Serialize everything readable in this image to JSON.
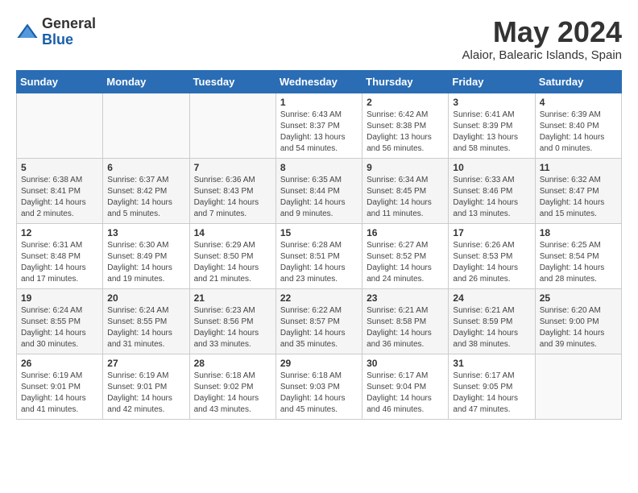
{
  "header": {
    "logo_general": "General",
    "logo_blue": "Blue",
    "month": "May 2024",
    "location": "Alaior, Balearic Islands, Spain"
  },
  "weekdays": [
    "Sunday",
    "Monday",
    "Tuesday",
    "Wednesday",
    "Thursday",
    "Friday",
    "Saturday"
  ],
  "weeks": [
    [
      {
        "day": "",
        "info": ""
      },
      {
        "day": "",
        "info": ""
      },
      {
        "day": "",
        "info": ""
      },
      {
        "day": "1",
        "info": "Sunrise: 6:43 AM\nSunset: 8:37 PM\nDaylight: 13 hours\nand 54 minutes."
      },
      {
        "day": "2",
        "info": "Sunrise: 6:42 AM\nSunset: 8:38 PM\nDaylight: 13 hours\nand 56 minutes."
      },
      {
        "day": "3",
        "info": "Sunrise: 6:41 AM\nSunset: 8:39 PM\nDaylight: 13 hours\nand 58 minutes."
      },
      {
        "day": "4",
        "info": "Sunrise: 6:39 AM\nSunset: 8:40 PM\nDaylight: 14 hours\nand 0 minutes."
      }
    ],
    [
      {
        "day": "5",
        "info": "Sunrise: 6:38 AM\nSunset: 8:41 PM\nDaylight: 14 hours\nand 2 minutes."
      },
      {
        "day": "6",
        "info": "Sunrise: 6:37 AM\nSunset: 8:42 PM\nDaylight: 14 hours\nand 5 minutes."
      },
      {
        "day": "7",
        "info": "Sunrise: 6:36 AM\nSunset: 8:43 PM\nDaylight: 14 hours\nand 7 minutes."
      },
      {
        "day": "8",
        "info": "Sunrise: 6:35 AM\nSunset: 8:44 PM\nDaylight: 14 hours\nand 9 minutes."
      },
      {
        "day": "9",
        "info": "Sunrise: 6:34 AM\nSunset: 8:45 PM\nDaylight: 14 hours\nand 11 minutes."
      },
      {
        "day": "10",
        "info": "Sunrise: 6:33 AM\nSunset: 8:46 PM\nDaylight: 14 hours\nand 13 minutes."
      },
      {
        "day": "11",
        "info": "Sunrise: 6:32 AM\nSunset: 8:47 PM\nDaylight: 14 hours\nand 15 minutes."
      }
    ],
    [
      {
        "day": "12",
        "info": "Sunrise: 6:31 AM\nSunset: 8:48 PM\nDaylight: 14 hours\nand 17 minutes."
      },
      {
        "day": "13",
        "info": "Sunrise: 6:30 AM\nSunset: 8:49 PM\nDaylight: 14 hours\nand 19 minutes."
      },
      {
        "day": "14",
        "info": "Sunrise: 6:29 AM\nSunset: 8:50 PM\nDaylight: 14 hours\nand 21 minutes."
      },
      {
        "day": "15",
        "info": "Sunrise: 6:28 AM\nSunset: 8:51 PM\nDaylight: 14 hours\nand 23 minutes."
      },
      {
        "day": "16",
        "info": "Sunrise: 6:27 AM\nSunset: 8:52 PM\nDaylight: 14 hours\nand 24 minutes."
      },
      {
        "day": "17",
        "info": "Sunrise: 6:26 AM\nSunset: 8:53 PM\nDaylight: 14 hours\nand 26 minutes."
      },
      {
        "day": "18",
        "info": "Sunrise: 6:25 AM\nSunset: 8:54 PM\nDaylight: 14 hours\nand 28 minutes."
      }
    ],
    [
      {
        "day": "19",
        "info": "Sunrise: 6:24 AM\nSunset: 8:55 PM\nDaylight: 14 hours\nand 30 minutes."
      },
      {
        "day": "20",
        "info": "Sunrise: 6:24 AM\nSunset: 8:55 PM\nDaylight: 14 hours\nand 31 minutes."
      },
      {
        "day": "21",
        "info": "Sunrise: 6:23 AM\nSunset: 8:56 PM\nDaylight: 14 hours\nand 33 minutes."
      },
      {
        "day": "22",
        "info": "Sunrise: 6:22 AM\nSunset: 8:57 PM\nDaylight: 14 hours\nand 35 minutes."
      },
      {
        "day": "23",
        "info": "Sunrise: 6:21 AM\nSunset: 8:58 PM\nDaylight: 14 hours\nand 36 minutes."
      },
      {
        "day": "24",
        "info": "Sunrise: 6:21 AM\nSunset: 8:59 PM\nDaylight: 14 hours\nand 38 minutes."
      },
      {
        "day": "25",
        "info": "Sunrise: 6:20 AM\nSunset: 9:00 PM\nDaylight: 14 hours\nand 39 minutes."
      }
    ],
    [
      {
        "day": "26",
        "info": "Sunrise: 6:19 AM\nSunset: 9:01 PM\nDaylight: 14 hours\nand 41 minutes."
      },
      {
        "day": "27",
        "info": "Sunrise: 6:19 AM\nSunset: 9:01 PM\nDaylight: 14 hours\nand 42 minutes."
      },
      {
        "day": "28",
        "info": "Sunrise: 6:18 AM\nSunset: 9:02 PM\nDaylight: 14 hours\nand 43 minutes."
      },
      {
        "day": "29",
        "info": "Sunrise: 6:18 AM\nSunset: 9:03 PM\nDaylight: 14 hours\nand 45 minutes."
      },
      {
        "day": "30",
        "info": "Sunrise: 6:17 AM\nSunset: 9:04 PM\nDaylight: 14 hours\nand 46 minutes."
      },
      {
        "day": "31",
        "info": "Sunrise: 6:17 AM\nSunset: 9:05 PM\nDaylight: 14 hours\nand 47 minutes."
      },
      {
        "day": "",
        "info": ""
      }
    ]
  ]
}
